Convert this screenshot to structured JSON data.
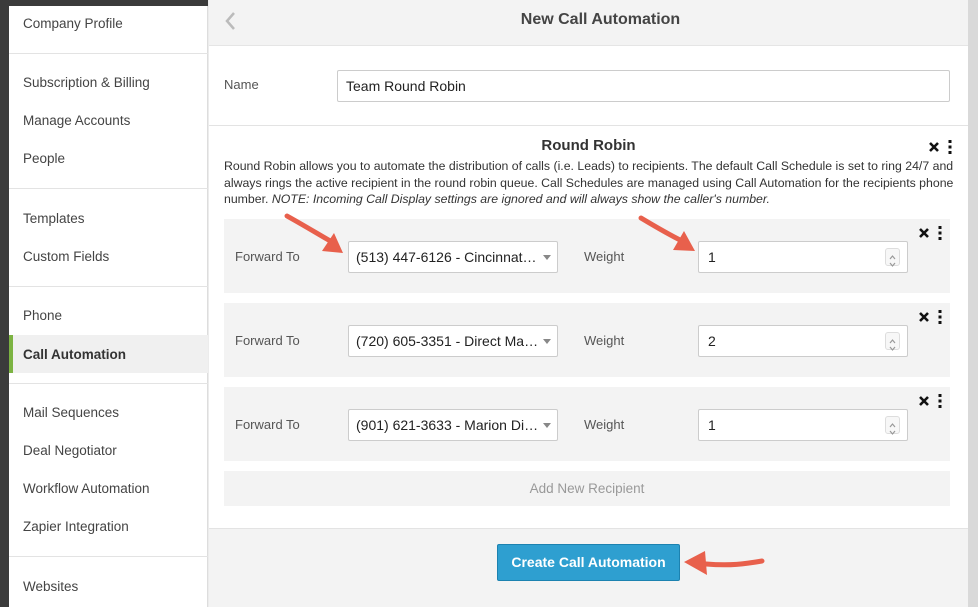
{
  "sidebar": {
    "items": [
      {
        "label": "Company Profile"
      },
      {
        "label": "Subscription & Billing"
      },
      {
        "label": "Manage Accounts"
      },
      {
        "label": "People"
      },
      {
        "label": "Templates"
      },
      {
        "label": "Custom Fields"
      },
      {
        "label": "Phone"
      },
      {
        "label": "Call Automation",
        "active": true
      },
      {
        "label": "Mail Sequences"
      },
      {
        "label": "Deal Negotiator"
      },
      {
        "label": "Workflow Automation"
      },
      {
        "label": "Zapier Integration"
      },
      {
        "label": "Websites"
      }
    ]
  },
  "header": {
    "title": "New Call Automation"
  },
  "form": {
    "name_label": "Name",
    "name_value": "Team Round Robin"
  },
  "round_robin": {
    "title": "Round Robin",
    "description": "Round Robin allows you to automate the distribution of calls (i.e. Leads) to recipients. The default Call Schedule is set to ring 24/7 and always rings the active recipient in the round robin queue. Call Schedules are managed using Call Automation for the recipients phone number. ",
    "note": "NOTE: Incoming Call Display settings are ignored and will always show the caller's number.",
    "recipients": [
      {
        "forward_label": "Forward To",
        "forward_value": "(513) 447-6126 - Cincinnati ...",
        "weight_label": "Weight",
        "weight_value": "1"
      },
      {
        "forward_label": "Forward To",
        "forward_value": "(720) 605-3351 - Direct Mail ...",
        "weight_label": "Weight",
        "weight_value": "2"
      },
      {
        "forward_label": "Forward To",
        "forward_value": "(901) 621-3633 - Marion Dir...",
        "weight_label": "Weight",
        "weight_value": "1"
      }
    ],
    "add_recipient_label": "Add New Recipient"
  },
  "footer": {
    "create_label": "Create Call Automation"
  },
  "colors": {
    "accent_blue": "#2e9fd0",
    "active_indicator": "#7cb342",
    "annotation_arrow": "#e8604c"
  }
}
